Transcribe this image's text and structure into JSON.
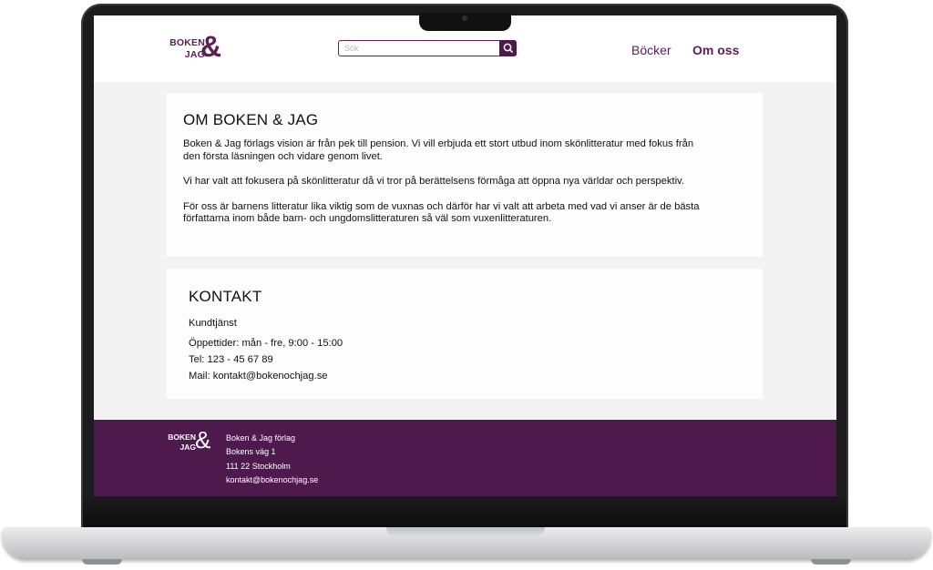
{
  "header": {
    "logo": {
      "line1": "BOKEN",
      "line2": "JAG",
      "amp": "&"
    },
    "search": {
      "placeholder": "Sök",
      "icon": "search-icon"
    },
    "nav": {
      "books": "Böcker",
      "about": "Om oss"
    }
  },
  "about": {
    "title": "OM BOKEN & JAG",
    "paragraphs": [
      "Boken & Jag förlags vision är från pek till pension. Vi vill erbjuda ett stort utbud inom skönlitteratur med fokus från den första läsningen och vidare genom livet.",
      "Vi har valt att fokusera på skönlitteratur då vi tror på berättelsens förmåga att öppna nya världar och perspektiv.",
      "För oss är barnens litteratur lika viktig som de vuxnas och därför har vi valt att arbeta med vad vi anser är de bästa författarna inom både barn- och ungdomslitteraturen så väl som vuxenlitteraturen."
    ]
  },
  "contact": {
    "title": "KONTAKT",
    "service": "Kundtjänst",
    "hours": "Öppettider: mån - fre, 9:00 - 15:00",
    "phone": "Tel: 123 - 45 67 89",
    "mail": "Mail: kontakt@bokenochjag.se"
  },
  "footer": {
    "logo": {
      "line1": "BOKEN",
      "line2": "JAG",
      "amp": "&"
    },
    "address": [
      "Boken & Jag förlag",
      "Bokens väg 1",
      "111 22 Stockholm",
      "kontakt@bokenochjag.se"
    ]
  },
  "colors": {
    "brand": "#5a2058",
    "footer_bg": "#4e1a4e",
    "page_bg": "#f3f3f3"
  }
}
